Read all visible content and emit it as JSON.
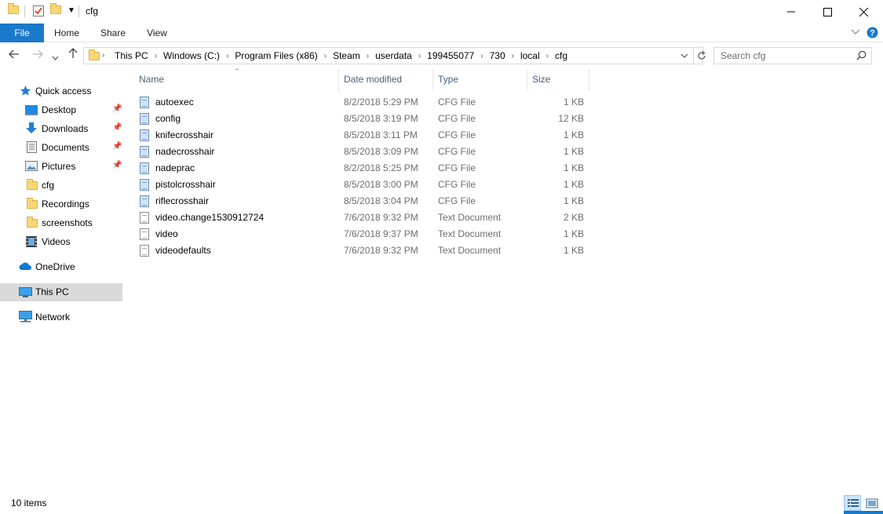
{
  "window": {
    "title": "cfg"
  },
  "ribbon": {
    "tabs": [
      "File",
      "Home",
      "Share",
      "View"
    ]
  },
  "address": {
    "breadcrumbs": [
      "This PC",
      "Windows (C:)",
      "Program Files (x86)",
      "Steam",
      "userdata",
      "199455077",
      "730",
      "local",
      "cfg"
    ]
  },
  "search": {
    "placeholder": "Search cfg"
  },
  "nav": {
    "quick_access": "Quick access",
    "items": [
      {
        "label": "Desktop",
        "pinned": true
      },
      {
        "label": "Downloads",
        "pinned": true
      },
      {
        "label": "Documents",
        "pinned": true
      },
      {
        "label": "Pictures",
        "pinned": true
      },
      {
        "label": "cfg",
        "pinned": false
      },
      {
        "label": "Recordings",
        "pinned": false
      },
      {
        "label": "screenshots",
        "pinned": false
      },
      {
        "label": "Videos",
        "pinned": false
      }
    ],
    "onedrive": "OneDrive",
    "this_pc": "This PC",
    "network": "Network"
  },
  "columns": {
    "name": "Name",
    "date": "Date modified",
    "type": "Type",
    "size": "Size"
  },
  "files": [
    {
      "name": "autoexec",
      "date": "8/2/2018 5:29 PM",
      "type": "CFG File",
      "size": "1 KB",
      "kind": "cfg"
    },
    {
      "name": "config",
      "date": "8/5/2018 3:19 PM",
      "type": "CFG File",
      "size": "12 KB",
      "kind": "cfg"
    },
    {
      "name": "knifecrosshair",
      "date": "8/5/2018 3:11 PM",
      "type": "CFG File",
      "size": "1 KB",
      "kind": "cfg"
    },
    {
      "name": "nadecrosshair",
      "date": "8/5/2018 3:09 PM",
      "type": "CFG File",
      "size": "1 KB",
      "kind": "cfg"
    },
    {
      "name": "nadeprac",
      "date": "8/2/2018 5:25 PM",
      "type": "CFG File",
      "size": "1 KB",
      "kind": "cfg"
    },
    {
      "name": "pistolcrosshair",
      "date": "8/5/2018 3:00 PM",
      "type": "CFG File",
      "size": "1 KB",
      "kind": "cfg"
    },
    {
      "name": "riflecrosshair",
      "date": "8/5/2018 3:04 PM",
      "type": "CFG File",
      "size": "1 KB",
      "kind": "cfg"
    },
    {
      "name": "video.change1530912724",
      "date": "7/6/2018 9:32 PM",
      "type": "Text Document",
      "size": "2 KB",
      "kind": "txt"
    },
    {
      "name": "video",
      "date": "7/6/2018 9:37 PM",
      "type": "Text Document",
      "size": "1 KB",
      "kind": "txt"
    },
    {
      "name": "videodefaults",
      "date": "7/6/2018 9:32 PM",
      "type": "Text Document",
      "size": "1 KB",
      "kind": "txt"
    }
  ],
  "status": {
    "item_count": "10 items"
  },
  "colors": {
    "accent": "#1979ca",
    "selected_nav": "#d9d9d9",
    "header_text": "#4c607a"
  }
}
